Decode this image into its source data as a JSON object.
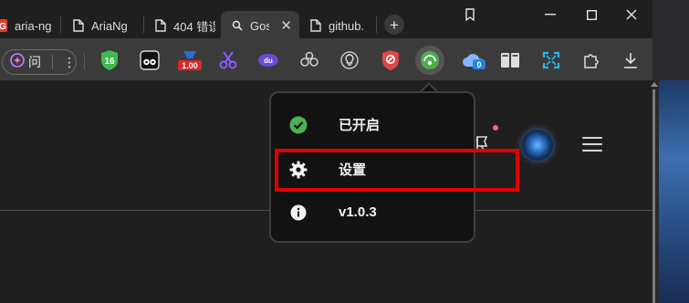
{
  "tabs": [
    {
      "label": "aria-ng",
      "icon": "red-g-favicon"
    },
    {
      "label": "AriaNg",
      "icon": "document-icon"
    },
    {
      "label": "404 错误",
      "icon": "document-icon"
    },
    {
      "label": "Gosp",
      "icon": "search-icon",
      "active": true
    },
    {
      "label": "github.",
      "icon": "document-icon"
    }
  ],
  "toolbar": {
    "profile_label": "问",
    "extensions": [
      {
        "name": "shield-16-icon",
        "text": "16"
      },
      {
        "name": "tampermonkey-icon"
      },
      {
        "name": "counter-icon",
        "text": "1.00"
      },
      {
        "name": "scissors-icon"
      },
      {
        "name": "translate-du-icon",
        "text": "du"
      },
      {
        "name": "share-nodes-icon"
      },
      {
        "name": "bulb-icon"
      },
      {
        "name": "block-shield-icon"
      },
      {
        "name": "aria-download-icon"
      },
      {
        "name": "cloud-badge-icon",
        "text": "0"
      },
      {
        "name": "reader-icon"
      },
      {
        "name": "fullscreen-icon"
      },
      {
        "name": "extensions-puzzle-icon"
      },
      {
        "name": "download-icon"
      }
    ]
  },
  "menu": {
    "items": [
      {
        "label": "已开启",
        "icon": "check-circle-icon"
      },
      {
        "label": "设置",
        "icon": "gear-icon"
      },
      {
        "label": "v1.0.3",
        "icon": "info-icon"
      }
    ]
  },
  "colors": {
    "highlight": "#e00000",
    "check_green": "#4caf50",
    "badge_dot": "#ff6b6b"
  }
}
